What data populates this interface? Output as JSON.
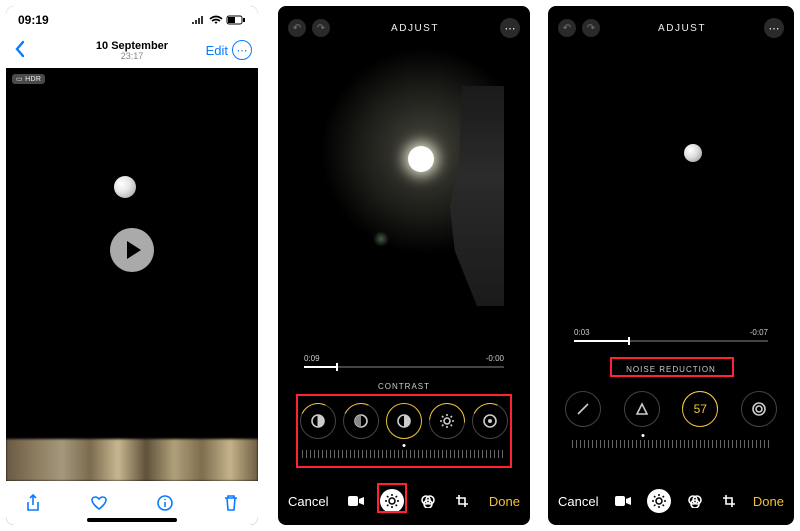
{
  "screen1": {
    "status_time": "09:19",
    "battery": "47",
    "date": "10 September",
    "time": "23:17",
    "edit_label": "Edit",
    "hdr_badge": "▭ HDR"
  },
  "screen2": {
    "title": "ADJUST",
    "time_current": "0:09",
    "time_remaining": "-0:00",
    "adjustment_label": "CONTRAST",
    "cancel_label": "Cancel",
    "done_label": "Done",
    "adjustments": [
      {
        "id": "exposure"
      },
      {
        "id": "highlights"
      },
      {
        "id": "contrast"
      },
      {
        "id": "brightness"
      },
      {
        "id": "black-point"
      }
    ]
  },
  "screen3": {
    "title": "ADJUST",
    "time_current": "0:03",
    "time_remaining": "-0:07",
    "adjustment_label": "NOISE REDUCTION",
    "cancel_label": "Cancel",
    "done_label": "Done",
    "nr_value": "57",
    "adjustments": [
      {
        "id": "sharpness"
      },
      {
        "id": "definition"
      },
      {
        "id": "noise-reduction",
        "value": "57"
      },
      {
        "id": "vignette"
      }
    ]
  }
}
